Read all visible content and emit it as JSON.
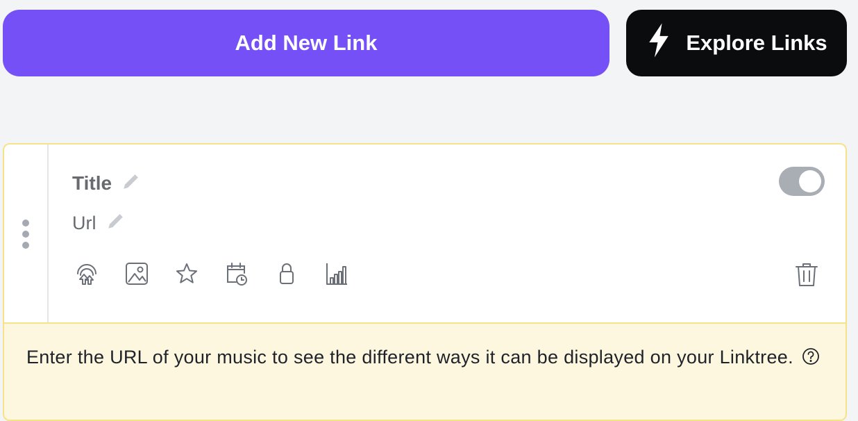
{
  "top_bar": {
    "add_button_label": "Add New Link",
    "explore_button_label": "Explore Links",
    "explore_icon": "lightning-bolt-icon"
  },
  "link_card": {
    "title_label": "Title",
    "url_label": "Url",
    "toggle_state": "on",
    "tools": [
      {
        "name": "redirect-icon"
      },
      {
        "name": "thumbnail-icon"
      },
      {
        "name": "star-icon"
      },
      {
        "name": "schedule-icon"
      },
      {
        "name": "lock-icon"
      },
      {
        "name": "analytics-icon"
      }
    ],
    "delete_icon": "trash-icon",
    "notice_text": "Enter the URL of your music to see the different ways it can be displayed on your Linktree.",
    "help_icon": "question-circle-icon"
  },
  "colors": {
    "accent": "#7650f7",
    "dark_button": "#0b0c0d",
    "card_border": "#f5e289",
    "notice_bg": "#fdf7e0",
    "toggle": "#a9adb4"
  }
}
